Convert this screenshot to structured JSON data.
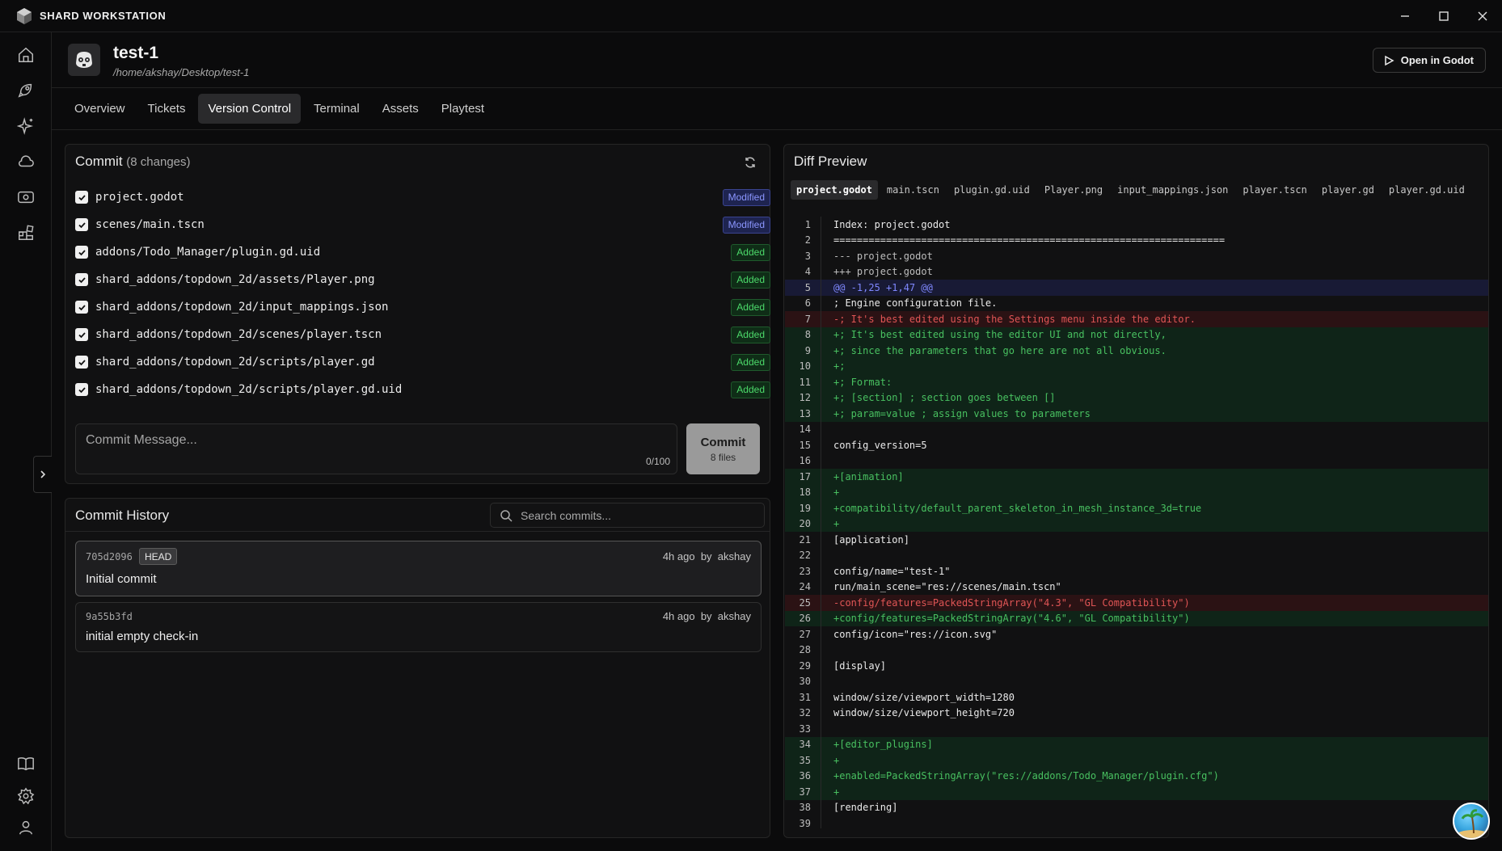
{
  "app": {
    "title": "SHARD WORKSTATION"
  },
  "window_controls": {
    "minimize": "–",
    "maximize": "☐",
    "close": "✕"
  },
  "project": {
    "name": "test-1",
    "path": "/home/akshay/Desktop/test-1",
    "open_button": "Open in Godot"
  },
  "tabs": [
    {
      "label": "Overview"
    },
    {
      "label": "Tickets"
    },
    {
      "label": "Version Control"
    },
    {
      "label": "Terminal"
    },
    {
      "label": "Assets"
    },
    {
      "label": "Playtest"
    }
  ],
  "active_tab": "Version Control",
  "commit": {
    "title": "Commit",
    "changes": "(8 changes)",
    "files": [
      {
        "path": "project.godot",
        "status": "Modified"
      },
      {
        "path": "scenes/main.tscn",
        "status": "Modified"
      },
      {
        "path": "addons/Todo_Manager/plugin.gd.uid",
        "status": "Added"
      },
      {
        "path": "shard_addons/topdown_2d/assets/Player.png",
        "status": "Added"
      },
      {
        "path": "shard_addons/topdown_2d/input_mappings.json",
        "status": "Added"
      },
      {
        "path": "shard_addons/topdown_2d/scenes/player.tscn",
        "status": "Added"
      },
      {
        "path": "shard_addons/topdown_2d/scripts/player.gd",
        "status": "Added"
      },
      {
        "path": "shard_addons/topdown_2d/scripts/player.gd.uid",
        "status": "Added"
      }
    ],
    "message_placeholder": "Commit Message...",
    "char_count": "0/100",
    "button_label": "Commit",
    "button_sub": "8 files"
  },
  "history": {
    "title": "Commit History",
    "search_placeholder": "Search commits...",
    "commits": [
      {
        "hash": "705d2096",
        "badge": "HEAD",
        "time": "4h ago",
        "by": "by",
        "author": "akshay",
        "message": "Initial commit"
      },
      {
        "hash": "9a55b3fd",
        "badge": "",
        "time": "4h ago",
        "by": "by",
        "author": "akshay",
        "message": "initial empty check-in"
      }
    ]
  },
  "diff": {
    "title": "Diff Preview",
    "files": [
      "project.godot",
      "main.tscn",
      "plugin.gd.uid",
      "Player.png",
      "input_mappings.json",
      "player.tscn",
      "player.gd",
      "player.gd.uid"
    ],
    "active_file": "project.godot",
    "lines": [
      {
        "n": "1",
        "t": "head",
        "c": "Index: project.godot"
      },
      {
        "n": "2",
        "t": "head",
        "c": "==================================================================="
      },
      {
        "n": "3",
        "t": "meta-line",
        "c": "--- project.godot"
      },
      {
        "n": "4",
        "t": "meta-line",
        "c": "+++ project.godot"
      },
      {
        "n": "5",
        "t": "hunk",
        "c": "@@ -1,25 +1,47 @@"
      },
      {
        "n": "6",
        "t": "plain",
        "c": "; Engine configuration file."
      },
      {
        "n": "7",
        "t": "del",
        "c": "-; It's best edited using the Settings menu inside the editor."
      },
      {
        "n": "8",
        "t": "add",
        "c": "+; It's best edited using the editor UI and not directly,"
      },
      {
        "n": "9",
        "t": "add",
        "c": "+; since the parameters that go here are not all obvious."
      },
      {
        "n": "10",
        "t": "add",
        "c": "+;"
      },
      {
        "n": "11",
        "t": "add",
        "c": "+; Format:"
      },
      {
        "n": "12",
        "t": "add",
        "c": "+; [section] ; section goes between []"
      },
      {
        "n": "13",
        "t": "add",
        "c": "+; param=value ; assign values to parameters"
      },
      {
        "n": "14",
        "t": "plain",
        "c": ""
      },
      {
        "n": "15",
        "t": "plain",
        "c": "config_version=5"
      },
      {
        "n": "16",
        "t": "plain",
        "c": ""
      },
      {
        "n": "17",
        "t": "add",
        "c": "+[animation]"
      },
      {
        "n": "18",
        "t": "add",
        "c": "+"
      },
      {
        "n": "19",
        "t": "add",
        "c": "+compatibility/default_parent_skeleton_in_mesh_instance_3d=true"
      },
      {
        "n": "20",
        "t": "add",
        "c": "+"
      },
      {
        "n": "21",
        "t": "plain",
        "c": "[application]"
      },
      {
        "n": "22",
        "t": "plain",
        "c": ""
      },
      {
        "n": "23",
        "t": "plain",
        "c": "config/name=\"test-1\""
      },
      {
        "n": "24",
        "t": "plain",
        "c": "run/main_scene=\"res://scenes/main.tscn\""
      },
      {
        "n": "25",
        "t": "del",
        "c": "-config/features=PackedStringArray(\"4.3\", \"GL Compatibility\")"
      },
      {
        "n": "26",
        "t": "add",
        "c": "+config/features=PackedStringArray(\"4.6\", \"GL Compatibility\")"
      },
      {
        "n": "27",
        "t": "plain",
        "c": "config/icon=\"res://icon.svg\""
      },
      {
        "n": "28",
        "t": "plain",
        "c": ""
      },
      {
        "n": "29",
        "t": "plain",
        "c": "[display]"
      },
      {
        "n": "30",
        "t": "plain",
        "c": ""
      },
      {
        "n": "31",
        "t": "plain",
        "c": "window/size/viewport_width=1280"
      },
      {
        "n": "32",
        "t": "plain",
        "c": "window/size/viewport_height=720"
      },
      {
        "n": "33",
        "t": "plain",
        "c": ""
      },
      {
        "n": "34",
        "t": "add",
        "c": "+[editor_plugins]"
      },
      {
        "n": "35",
        "t": "add",
        "c": "+"
      },
      {
        "n": "36",
        "t": "add",
        "c": "+enabled=PackedStringArray(\"res://addons/Todo_Manager/plugin.cfg\")"
      },
      {
        "n": "37",
        "t": "add",
        "c": "+"
      },
      {
        "n": "38",
        "t": "plain",
        "c": "[rendering]"
      },
      {
        "n": "39",
        "t": "plain",
        "c": ""
      }
    ]
  },
  "sidebar_icons": [
    "home-icon",
    "rocket-icon",
    "sparkles-icon",
    "cloud-icon",
    "eye-icon",
    "blocks-icon",
    "book-icon",
    "gear-icon",
    "user-icon"
  ]
}
